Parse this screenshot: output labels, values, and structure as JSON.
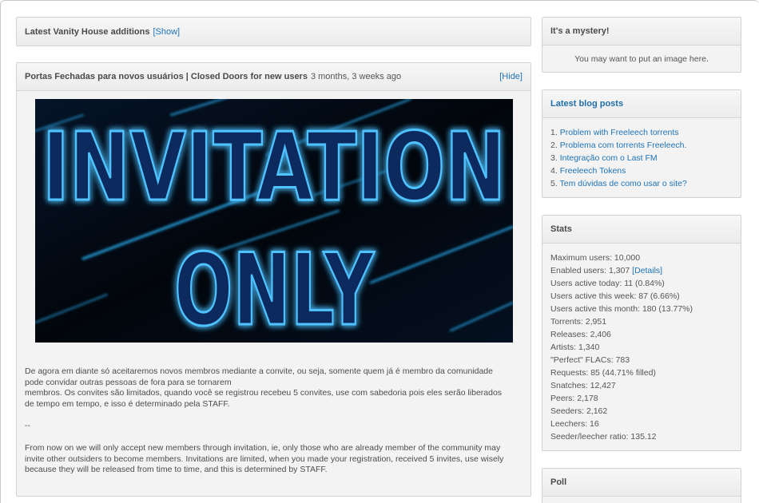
{
  "vanity": {
    "title": "Latest Vanity House additions",
    "toggle": "[Show]"
  },
  "news": {
    "title": "Portas Fechadas para novos usuários | Closed Doors for new users",
    "age": "3 months, 3 weeks ago",
    "toggle": "[Hide]",
    "banner_line1": "INVITATION",
    "banner_line2": "ONLY",
    "pt_line1": "De agora em diante só aceitaremos novos membros mediante a convite, ou seja, somente quem já é membro da comunidade",
    "pt_line2": "pode convidar outras pessoas de fora para se tornarem",
    "pt_line3": "membros. Os convites são limitados, quando você se registrou recebeu 5 convites, use com sabedoria pois eles serão liberados",
    "pt_line4": "de tempo em tempo, e isso é determinado pela STAFF.",
    "separator": "--",
    "en_line1": "From now on we will only accept new members through invitation, ie, only those who are already member of the community may",
    "en_line2": "invite other outsiders to become members. Invitations are limited, when you made your registration, received 5 invites, use wisely",
    "en_line3": "because they will be released from time to time, and this is determined by STAFF."
  },
  "mystery": {
    "title": "It's a mystery!",
    "text": "You may want to put an image here."
  },
  "blog": {
    "title": "Latest blog posts",
    "posts": [
      {
        "num": "1.",
        "title": "Problem with Freeleech torrents"
      },
      {
        "num": "2.",
        "title": "Problema com torrents Freeleech."
      },
      {
        "num": "3.",
        "title": "Integração com o Last FM"
      },
      {
        "num": "4.",
        "title": "Freeleech Tokens"
      },
      {
        "num": "5.",
        "title": "Tem dúvidas de como usar o site?"
      }
    ]
  },
  "stats": {
    "title": "Stats",
    "max_users": "Maximum users: 10,000",
    "enabled_users": "Enabled users: 1,307",
    "details_link": "[Details]",
    "active_today": "Users active today: 11 (0.84%)",
    "active_week": "Users active this week: 87 (6.66%)",
    "active_month": "Users active this month: 180 (13.77%)",
    "torrents": "Torrents: 2,951",
    "releases": "Releases: 2,406",
    "artists": "Artists: 1,340",
    "perfect_flacs": "\"Perfect\" FLACs: 783",
    "requests": "Requests: 85 (44.71% filled)",
    "snatches": "Snatches: 12,427",
    "peers": "Peers: 2,178",
    "seeders": "Seeders: 2,162",
    "leechers": "Leechers: 16",
    "ratio": "Seeder/leecher ratio: 135.12"
  },
  "poll": {
    "title": "Poll"
  },
  "colors": {
    "link": "#1f73b5",
    "banner_glow": "#1e90ff",
    "banner_bg": "#02060c"
  }
}
